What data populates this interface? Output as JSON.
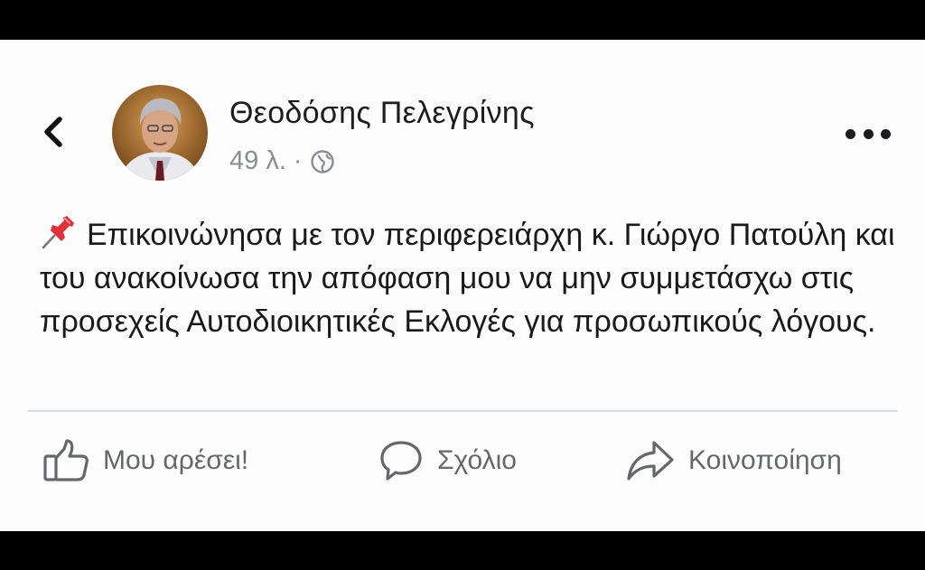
{
  "post": {
    "author": "Θεοδόσης Πελεγρίνης",
    "time": "49 λ.",
    "separator": "·",
    "audience_icon": "globe-icon",
    "pin_icon": "pushpin-icon",
    "text": "Επικοινώνησα με τον περιφερειάρχη κ. Γιώργο Πατούλη και του ανακοίνωσα την απόφαση μου να μην συμμετάσχω στις προσεχείς Αυτοδιοικητικές Εκλογές για προσωπικούς λόγους."
  },
  "actions": {
    "like_label": "Μου αρέσει!",
    "comment_label": "Σχόλιο",
    "share_label": "Κοινοποίηση"
  },
  "colors": {
    "text": "#1a1a1a",
    "muted": "#65676b",
    "divider": "#dadde1",
    "pin": "#e0303a"
  }
}
